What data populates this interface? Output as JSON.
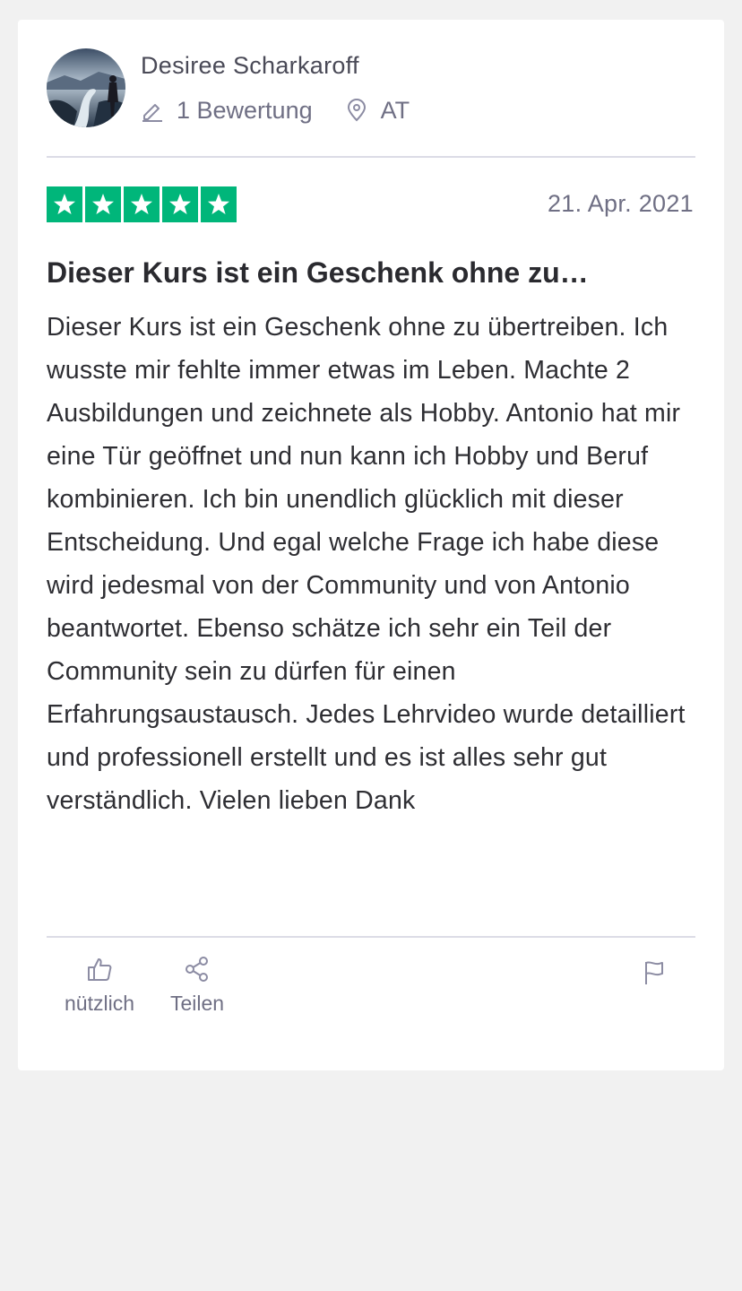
{
  "reviewer": {
    "name": "Desiree Scharkaroff",
    "review_count": "1 Bewertung",
    "country": "AT"
  },
  "review": {
    "rating": 5,
    "rating_max": 5,
    "star_color": "#00b67a",
    "date": "21. Apr. 2021",
    "title": "Dieser Kurs ist ein Geschenk ohne zu…",
    "body": "Dieser Kurs ist ein Geschenk ohne zu übertreiben. Ich wusste mir fehlte immer etwas im Leben. Machte 2 Ausbildungen und zeichnete als Hobby. Antonio hat mir eine Tür geöffnet und nun kann ich Hobby und Beruf kombinieren. Ich bin unendlich glücklich mit dieser Entscheidung. Und egal welche Frage ich habe diese wird jedesmal von der Community und von Antonio beantwortet. Ebenso schätze ich sehr ein Teil der Community sein zu dürfen für einen Erfahrungsaustausch. Jedes Lehrvideo wurde detailliert und professionell erstellt und es ist alles sehr gut verständlich. Vielen lieben Dank"
  },
  "actions": {
    "useful_label": "nützlich",
    "share_label": "Teilen"
  },
  "icons": {
    "avatar": "avatar-photo",
    "review_count": "pencil-icon",
    "country": "location-pin-icon",
    "useful": "thumbs-up-icon",
    "share": "share-icon",
    "report": "flag-icon"
  }
}
